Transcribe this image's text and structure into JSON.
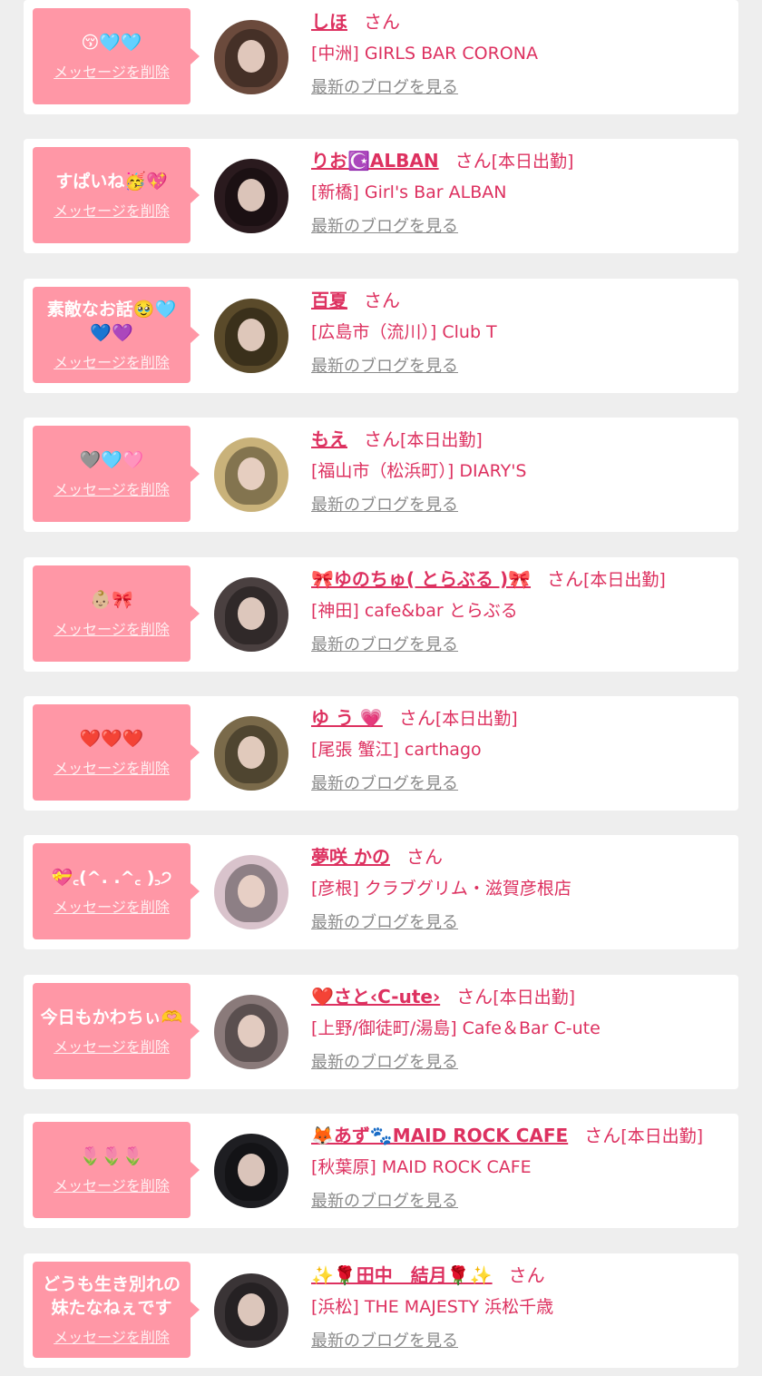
{
  "colors": {
    "accent": "#dd3160",
    "bubble": "#ff97a6",
    "page_bg": "#eeeeee",
    "card_bg": "#ffffff",
    "link_gray": "#8a8a8a"
  },
  "labels": {
    "san": "さん",
    "delete": "メッセージを削除",
    "blog": "最新のブログを見る"
  },
  "entries": [
    {
      "message": "😚🩵🩵",
      "name": "しほ",
      "status": "",
      "shop": "[中洲] GIRLS BAR CORONA",
      "avatar_color": "#6b4a3c"
    },
    {
      "message": "すぱいね🥳💖",
      "name": "りお☪️ALBAN",
      "status": "[本日出勤]",
      "shop": "[新橋] Girl's Bar ALBAN",
      "avatar_color": "#2a1a1e"
    },
    {
      "message": "素敵なお話🥹🩵💙💜",
      "name": "百夏",
      "status": "",
      "shop": "[広島市（流川）] Club T",
      "avatar_color": "#5a4a2a"
    },
    {
      "message": "🩶🩵🩷",
      "name": "もえ",
      "status": "[本日出勤]",
      "shop": "[福山市（松浜町）] DIARY'S",
      "avatar_color": "#c9b27a"
    },
    {
      "message": "👶🏼🎀",
      "name": "🎀ゆのちゅ( とらぶる )🎀",
      "status": "[本日出勤]",
      "shop": "[神田] cafe&bar とらぶる",
      "avatar_color": "#4a4040"
    },
    {
      "message": "❤️❤️❤️",
      "name": "ゆ う 💗",
      "status": "[本日出勤]",
      "shop": "[尾張 蟹江] carthago",
      "avatar_color": "#7a6a4a"
    },
    {
      "message": "💝꜀(^. .^꜀ )꜆੭",
      "name": "夢咲 かの",
      "status": "",
      "shop": "[彦根] クラブグリム・滋賀彦根店",
      "avatar_color": "#d9c3cc"
    },
    {
      "message": "今日もかわちぃ🫶",
      "name": "❤️さと‹C-ute›",
      "status": "[本日出勤]",
      "shop": "[上野/御徒町/湯島] Cafe＆Bar C-ute",
      "avatar_color": "#8a7a7a"
    },
    {
      "message": "🌷🌷🌷",
      "name": "🦊あず🐾MAID ROCK CAFE",
      "status": "[本日出勤]",
      "shop": "[秋葉原] MAID ROCK CAFE",
      "avatar_color": "#1e1e22"
    },
    {
      "message": "どうも生き別れの妹たなねぇです",
      "name": "✨🌹田中　結月🌹✨",
      "status": "",
      "shop": "[浜松] THE MAJESTY 浜松千歳",
      "avatar_color": "#3a3436"
    }
  ]
}
